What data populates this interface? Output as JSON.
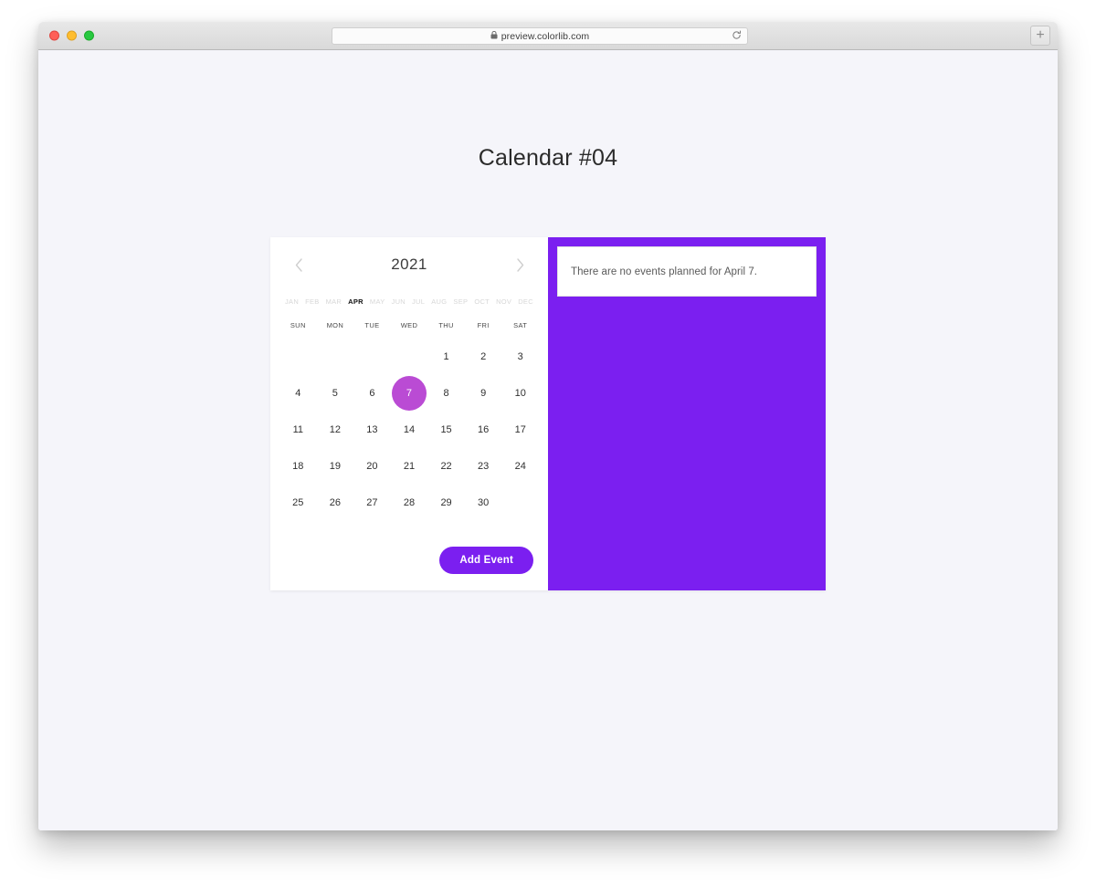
{
  "browser": {
    "url": "preview.colorlib.com",
    "lock_icon": "lock-icon",
    "reload_icon": "reload-icon",
    "newtab_label": "+",
    "traffic_lights": [
      "close",
      "minimize",
      "maximize"
    ]
  },
  "page": {
    "title": "Calendar #04",
    "background": "#f5f5fa"
  },
  "calendar": {
    "year": "2021",
    "prev_label": "‹",
    "next_label": "›",
    "months": [
      "JAN",
      "FEB",
      "MAR",
      "APR",
      "MAY",
      "JUN",
      "JUL",
      "AUG",
      "SEP",
      "OCT",
      "NOV",
      "DEC"
    ],
    "active_month": "APR",
    "active_month_index": 3,
    "weekdays": [
      "SUN",
      "MON",
      "TUE",
      "WED",
      "THU",
      "FRI",
      "SAT"
    ],
    "leading_blanks": 4,
    "days": [
      1,
      2,
      3,
      4,
      5,
      6,
      7,
      8,
      9,
      10,
      11,
      12,
      13,
      14,
      15,
      16,
      17,
      18,
      19,
      20,
      21,
      22,
      23,
      24,
      25,
      26,
      27,
      28,
      29,
      30
    ],
    "selected_day": 7,
    "selected_color": "#ba4bd4",
    "add_event_label": "Add Event",
    "accent_color": "#7b1ff0"
  },
  "events": {
    "message": "There are no events planned for April 7."
  }
}
